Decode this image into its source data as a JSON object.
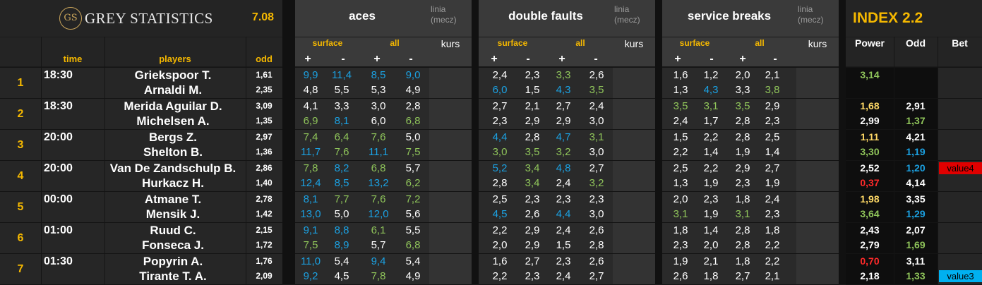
{
  "header": {
    "logo_mark": "GS",
    "brand": "GREY STATISTICS",
    "version": "7.08",
    "index_title": "INDEX 2.2",
    "sections": [
      {
        "title": "aces",
        "linia": [
          "linia",
          "(mecz)"
        ],
        "surface": "surface",
        "all": "all",
        "kurs": "kurs"
      },
      {
        "title": "double faults",
        "linia": [
          "linia",
          "(mecz)"
        ],
        "surface": "surface",
        "all": "all",
        "kurs": "kurs"
      },
      {
        "title": "service breaks",
        "linia": [
          "linia",
          "(mecz)"
        ],
        "surface": "surface",
        "all": "all",
        "kurs": "kurs"
      }
    ],
    "plus": "+",
    "minus": "-",
    "col_time": "time",
    "col_players": "players",
    "col_odd": "odd",
    "col_power": "Power",
    "col_index_odd": "Odd",
    "col_bet": "Bet"
  },
  "colors": {
    "white": "#ffffff",
    "blue": "#1ba1e2",
    "green": "#8fc45a",
    "yellow": "#ffd966",
    "red": "#ff2a2a",
    "lime": "#b5d77a",
    "badge_red": "#e00000",
    "badge_blue": "#00b0f0"
  },
  "matches": [
    {
      "num": "1",
      "time": "18:30",
      "p1": {
        "name": "Griekspoor T.",
        "odd": "1,61",
        "aces": [
          [
            "9,9",
            "blue"
          ],
          [
            "11,4",
            "blue"
          ],
          [
            "8,5",
            "blue"
          ],
          [
            "9,0",
            "blue"
          ]
        ],
        "df": [
          [
            "2,4",
            "white"
          ],
          [
            "2,3",
            "white"
          ],
          [
            "3,3",
            "green"
          ],
          [
            "2,6",
            "white"
          ]
        ],
        "sb": [
          [
            "1,6",
            "white"
          ],
          [
            "1,2",
            "white"
          ],
          [
            "2,0",
            "white"
          ],
          [
            "2,1",
            "white"
          ]
        ],
        "power": [
          "3,14",
          "green"
        ],
        "iodd": [
          "",
          ""
        ]
      },
      "p2": {
        "name": "Arnaldi M.",
        "odd": "2,35",
        "aces": [
          [
            "4,8",
            "white"
          ],
          [
            "5,5",
            "white"
          ],
          [
            "5,3",
            "white"
          ],
          [
            "4,9",
            "white"
          ]
        ],
        "df": [
          [
            "6,0",
            "blue"
          ],
          [
            "1,5",
            "white"
          ],
          [
            "4,3",
            "blue"
          ],
          [
            "3,5",
            "green"
          ]
        ],
        "sb": [
          [
            "1,3",
            "white"
          ],
          [
            "4,3",
            "blue"
          ],
          [
            "3,3",
            "white"
          ],
          [
            "3,8",
            "green"
          ]
        ],
        "power": [
          "",
          ""
        ],
        "iodd": [
          "",
          ""
        ]
      },
      "bet": [
        "",
        ""
      ]
    },
    {
      "num": "2",
      "time": "18:30",
      "p1": {
        "name": "Merida Aguilar D.",
        "odd": "3,09",
        "aces": [
          [
            "4,1",
            "white"
          ],
          [
            "3,3",
            "white"
          ],
          [
            "3,0",
            "white"
          ],
          [
            "2,8",
            "white"
          ]
        ],
        "df": [
          [
            "2,7",
            "white"
          ],
          [
            "2,1",
            "white"
          ],
          [
            "2,7",
            "white"
          ],
          [
            "2,4",
            "white"
          ]
        ],
        "sb": [
          [
            "3,5",
            "green"
          ],
          [
            "3,1",
            "green"
          ],
          [
            "3,5",
            "green"
          ],
          [
            "2,9",
            "white"
          ]
        ],
        "power": [
          "1,68",
          "yellow"
        ],
        "iodd": [
          "2,91",
          "white"
        ]
      },
      "p2": {
        "name": "Michelsen A.",
        "odd": "1,35",
        "aces": [
          [
            "6,9",
            "green"
          ],
          [
            "8,1",
            "blue"
          ],
          [
            "6,0",
            "white"
          ],
          [
            "6,8",
            "green"
          ]
        ],
        "df": [
          [
            "2,3",
            "white"
          ],
          [
            "2,9",
            "white"
          ],
          [
            "2,9",
            "white"
          ],
          [
            "3,0",
            "white"
          ]
        ],
        "sb": [
          [
            "2,4",
            "white"
          ],
          [
            "1,7",
            "white"
          ],
          [
            "2,8",
            "white"
          ],
          [
            "2,3",
            "white"
          ]
        ],
        "power": [
          "2,99",
          "white"
        ],
        "iodd": [
          "1,37",
          "green"
        ]
      },
      "bet": [
        "",
        ""
      ]
    },
    {
      "num": "3",
      "time": "20:00",
      "p1": {
        "name": "Bergs Z.",
        "odd": "2,97",
        "aces": [
          [
            "7,4",
            "green"
          ],
          [
            "6,4",
            "green"
          ],
          [
            "7,6",
            "green"
          ],
          [
            "5,0",
            "white"
          ]
        ],
        "df": [
          [
            "4,4",
            "blue"
          ],
          [
            "2,8",
            "white"
          ],
          [
            "4,7",
            "blue"
          ],
          [
            "3,1",
            "green"
          ]
        ],
        "sb": [
          [
            "1,5",
            "white"
          ],
          [
            "2,2",
            "white"
          ],
          [
            "2,8",
            "white"
          ],
          [
            "2,5",
            "white"
          ]
        ],
        "power": [
          "1,11",
          "yellow"
        ],
        "iodd": [
          "4,21",
          "white"
        ]
      },
      "p2": {
        "name": "Shelton B.",
        "odd": "1,36",
        "aces": [
          [
            "11,7",
            "blue"
          ],
          [
            "7,6",
            "green"
          ],
          [
            "11,1",
            "blue"
          ],
          [
            "7,5",
            "green"
          ]
        ],
        "df": [
          [
            "3,0",
            "green"
          ],
          [
            "3,5",
            "green"
          ],
          [
            "3,2",
            "green"
          ],
          [
            "3,0",
            "white"
          ]
        ],
        "sb": [
          [
            "2,2",
            "white"
          ],
          [
            "1,4",
            "white"
          ],
          [
            "1,9",
            "white"
          ],
          [
            "1,4",
            "white"
          ]
        ],
        "power": [
          "3,30",
          "green"
        ],
        "iodd": [
          "1,19",
          "blue"
        ]
      },
      "bet": [
        "",
        ""
      ]
    },
    {
      "num": "4",
      "time": "20:00",
      "p1": {
        "name": "Van De Zandschulp B.",
        "odd": "2,86",
        "aces": [
          [
            "7,8",
            "green"
          ],
          [
            "8,2",
            "blue"
          ],
          [
            "6,8",
            "green"
          ],
          [
            "5,7",
            "white"
          ]
        ],
        "df": [
          [
            "5,2",
            "blue"
          ],
          [
            "3,4",
            "green"
          ],
          [
            "4,8",
            "blue"
          ],
          [
            "2,7",
            "white"
          ]
        ],
        "sb": [
          [
            "2,5",
            "white"
          ],
          [
            "2,2",
            "white"
          ],
          [
            "2,9",
            "white"
          ],
          [
            "2,7",
            "white"
          ]
        ],
        "power": [
          "2,52",
          "white"
        ],
        "iodd": [
          "1,20",
          "blue"
        ]
      },
      "p2": {
        "name": "Hurkacz H.",
        "odd": "1,40",
        "aces": [
          [
            "12,4",
            "blue"
          ],
          [
            "8,5",
            "blue"
          ],
          [
            "13,2",
            "blue"
          ],
          [
            "6,2",
            "green"
          ]
        ],
        "df": [
          [
            "2,8",
            "white"
          ],
          [
            "3,4",
            "green"
          ],
          [
            "2,4",
            "white"
          ],
          [
            "3,2",
            "green"
          ]
        ],
        "sb": [
          [
            "1,3",
            "white"
          ],
          [
            "1,9",
            "white"
          ],
          [
            "2,3",
            "white"
          ],
          [
            "1,9",
            "white"
          ]
        ],
        "power": [
          "0,37",
          "red"
        ],
        "iodd": [
          "4,14",
          "white"
        ]
      },
      "bet": [
        "value4",
        ""
      ]
    },
    {
      "num": "5",
      "time": "00:00",
      "p1": {
        "name": "Atmane T.",
        "odd": "2,78",
        "aces": [
          [
            "8,1",
            "blue"
          ],
          [
            "7,7",
            "green"
          ],
          [
            "7,6",
            "green"
          ],
          [
            "7,2",
            "green"
          ]
        ],
        "df": [
          [
            "2,5",
            "white"
          ],
          [
            "2,3",
            "white"
          ],
          [
            "2,3",
            "white"
          ],
          [
            "2,3",
            "white"
          ]
        ],
        "sb": [
          [
            "2,0",
            "white"
          ],
          [
            "2,3",
            "white"
          ],
          [
            "1,8",
            "white"
          ],
          [
            "2,4",
            "white"
          ]
        ],
        "power": [
          "1,98",
          "yellow"
        ],
        "iodd": [
          "3,35",
          "white"
        ]
      },
      "p2": {
        "name": "Mensik J.",
        "odd": "1,42",
        "aces": [
          [
            "13,0",
            "blue"
          ],
          [
            "5,0",
            "white"
          ],
          [
            "12,0",
            "blue"
          ],
          [
            "5,6",
            "white"
          ]
        ],
        "df": [
          [
            "4,5",
            "blue"
          ],
          [
            "2,6",
            "white"
          ],
          [
            "4,4",
            "blue"
          ],
          [
            "3,0",
            "white"
          ]
        ],
        "sb": [
          [
            "3,1",
            "green"
          ],
          [
            "1,9",
            "white"
          ],
          [
            "3,1",
            "green"
          ],
          [
            "2,3",
            "white"
          ]
        ],
        "power": [
          "3,64",
          "green"
        ],
        "iodd": [
          "1,29",
          "blue"
        ]
      },
      "bet": [
        "",
        ""
      ]
    },
    {
      "num": "6",
      "time": "01:00",
      "p1": {
        "name": "Ruud C.",
        "odd": "2,15",
        "aces": [
          [
            "9,1",
            "blue"
          ],
          [
            "8,8",
            "blue"
          ],
          [
            "6,1",
            "green"
          ],
          [
            "5,5",
            "white"
          ]
        ],
        "df": [
          [
            "2,2",
            "white"
          ],
          [
            "2,9",
            "white"
          ],
          [
            "2,4",
            "white"
          ],
          [
            "2,6",
            "white"
          ]
        ],
        "sb": [
          [
            "1,8",
            "white"
          ],
          [
            "1,4",
            "white"
          ],
          [
            "2,8",
            "white"
          ],
          [
            "1,8",
            "white"
          ]
        ],
        "power": [
          "2,43",
          "white"
        ],
        "iodd": [
          "2,07",
          "white"
        ]
      },
      "p2": {
        "name": "Fonseca J.",
        "odd": "1,72",
        "aces": [
          [
            "7,5",
            "green"
          ],
          [
            "8,9",
            "blue"
          ],
          [
            "5,7",
            "white"
          ],
          [
            "6,8",
            "green"
          ]
        ],
        "df": [
          [
            "2,0",
            "white"
          ],
          [
            "2,9",
            "white"
          ],
          [
            "1,5",
            "white"
          ],
          [
            "2,8",
            "white"
          ]
        ],
        "sb": [
          [
            "2,3",
            "white"
          ],
          [
            "2,0",
            "white"
          ],
          [
            "2,8",
            "white"
          ],
          [
            "2,2",
            "white"
          ]
        ],
        "power": [
          "2,79",
          "white"
        ],
        "iodd": [
          "1,69",
          "green"
        ]
      },
      "bet": [
        "",
        ""
      ]
    },
    {
      "num": "7",
      "time": "01:30",
      "p1": {
        "name": "Popyrin A.",
        "odd": "1,76",
        "aces": [
          [
            "11,0",
            "blue"
          ],
          [
            "5,4",
            "white"
          ],
          [
            "9,4",
            "blue"
          ],
          [
            "5,4",
            "white"
          ]
        ],
        "df": [
          [
            "1,6",
            "white"
          ],
          [
            "2,7",
            "white"
          ],
          [
            "2,3",
            "white"
          ],
          [
            "2,6",
            "white"
          ]
        ],
        "sb": [
          [
            "1,9",
            "white"
          ],
          [
            "2,1",
            "white"
          ],
          [
            "1,8",
            "white"
          ],
          [
            "2,2",
            "white"
          ]
        ],
        "power": [
          "0,70",
          "red"
        ],
        "iodd": [
          "3,11",
          "white"
        ]
      },
      "p2": {
        "name": "Tirante T. A.",
        "odd": "2,09",
        "aces": [
          [
            "9,2",
            "blue"
          ],
          [
            "4,5",
            "white"
          ],
          [
            "7,8",
            "green"
          ],
          [
            "4,9",
            "white"
          ]
        ],
        "df": [
          [
            "2,2",
            "white"
          ],
          [
            "2,3",
            "white"
          ],
          [
            "2,4",
            "white"
          ],
          [
            "2,7",
            "white"
          ]
        ],
        "sb": [
          [
            "2,6",
            "white"
          ],
          [
            "1,8",
            "white"
          ],
          [
            "2,7",
            "white"
          ],
          [
            "2,1",
            "white"
          ]
        ],
        "power": [
          "2,18",
          "white"
        ],
        "iodd": [
          "1,33",
          "green"
        ]
      },
      "bet": [
        "",
        "value3"
      ]
    }
  ]
}
